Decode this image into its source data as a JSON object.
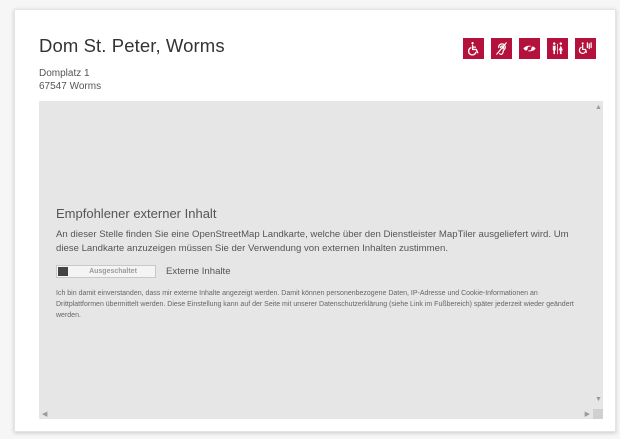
{
  "place": {
    "title": "Dom St. Peter, Worms",
    "address_line1": "Domplatz 1",
    "address_line2": "67547 Worms"
  },
  "accessibility_icons": [
    {
      "icon": "wheelchair-icon"
    },
    {
      "icon": "hearing-impaired-icon"
    },
    {
      "icon": "visually-impaired-icon"
    },
    {
      "icon": "restroom-icon"
    },
    {
      "icon": "assisted-access-icon"
    }
  ],
  "consent": {
    "heading": "Empfohlener externer Inhalt",
    "text": "An dieser Stelle finden Sie eine OpenStreetMap Landkarte, welche über den Dienstleister MapTiler ausgeliefert wird. Um diese Landkarte anzuzeigen müssen Sie der Verwendung von externen Inhalten zustimmen.",
    "toggle_state": "Ausgeschaltet",
    "toggle_label": "Externe Inhalte",
    "disclaimer": "Ich bin damit einverstanden, dass mir externe Inhalte angezeigt werden. Damit können personenbezogene Daten, IP-Adresse und Cookie-Informationen an Drittplattformen übermittelt werden. Diese Einstellung kann auf der Seite mit unserer Datenschutzerklä­rung (siehe Link im Fußbereich) später jederzeit wieder geändert werden."
  },
  "colors": {
    "accent": "#b4123c",
    "map_background": "#e6e6e6",
    "text": "#555555"
  }
}
